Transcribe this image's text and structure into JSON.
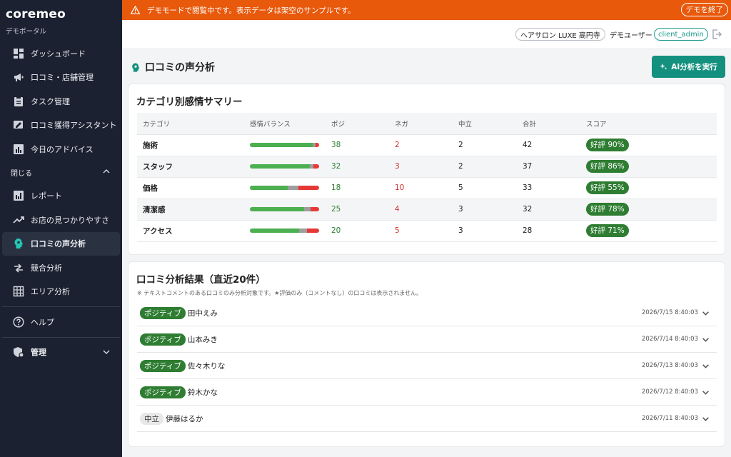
{
  "brand": {
    "name": "coremeo",
    "subtitle": "デモポータル"
  },
  "nav": {
    "items": [
      {
        "label": "ダッシュボード",
        "icon": "dashboard-icon"
      },
      {
        "label": "口コミ・店舗管理",
        "icon": "megaphone-icon"
      },
      {
        "label": "タスク管理",
        "icon": "clipboard-icon"
      },
      {
        "label": "口コミ獲得アシスタント",
        "icon": "edit-icon"
      },
      {
        "label": "今日のアドバイス",
        "icon": "bar-chart-icon"
      }
    ],
    "section_label": "閉じる",
    "section_items": [
      {
        "label": "レポート",
        "icon": "report-icon"
      },
      {
        "label": "お店の見つかりやすさ",
        "icon": "trending-up-icon"
      },
      {
        "label": "口コミの声分析",
        "icon": "head-icon",
        "active": true
      },
      {
        "label": "競合分析",
        "icon": "compare-icon"
      },
      {
        "label": "エリア分析",
        "icon": "grid-icon"
      }
    ],
    "help_label": "ヘルプ",
    "admin_label": "管理"
  },
  "banner": {
    "text": "デモモードで閲覧中です。表示データは架空のサンプルです。",
    "button": "デモを終了"
  },
  "header": {
    "store": "ヘアサロン LUXE 高円寺",
    "user_label": "デモユーザー",
    "user_id": "client_admin"
  },
  "page": {
    "title": "口コミの声分析",
    "ai_button": "AI分析を実行"
  },
  "summary": {
    "title": "カテゴリ別感情サマリー",
    "columns": [
      "カテゴリ",
      "感情バランス",
      "ポジ",
      "ネガ",
      "中立",
      "合計",
      "スコア"
    ],
    "rows": [
      {
        "category": "施術",
        "pos": "38",
        "neg": "2",
        "neu": "2",
        "total": "42",
        "score": "好評 90%",
        "p": 38,
        "n": 2,
        "m": 2
      },
      {
        "category": "スタッフ",
        "pos": "32",
        "neg": "3",
        "neu": "2",
        "total": "37",
        "score": "好評 86%",
        "p": 32,
        "n": 3,
        "m": 2
      },
      {
        "category": "価格",
        "pos": "18",
        "neg": "10",
        "neu": "5",
        "total": "33",
        "score": "好評 55%",
        "p": 18,
        "n": 10,
        "m": 5
      },
      {
        "category": "清潔感",
        "pos": "25",
        "neg": "4",
        "neu": "3",
        "total": "32",
        "score": "好評 78%",
        "p": 25,
        "n": 4,
        "m": 3
      },
      {
        "category": "アクセス",
        "pos": "20",
        "neg": "5",
        "neu": "3",
        "total": "28",
        "score": "好評 71%",
        "p": 20,
        "n": 5,
        "m": 3
      }
    ]
  },
  "results": {
    "title": "口コミ分析結果（直近20件）",
    "note": "※ テキストコメントのある口コミのみ分析対象です。★評価のみ（コメントなし）の口コミは表示されません。",
    "items": [
      {
        "tag": "ポジティブ",
        "type": "pos",
        "name": "田中えみ",
        "date": "2026/7/15 8:40:03"
      },
      {
        "tag": "ポジティブ",
        "type": "pos",
        "name": "山本みき",
        "date": "2026/7/14 8:40:03"
      },
      {
        "tag": "ポジティブ",
        "type": "pos",
        "name": "佐々木りな",
        "date": "2026/7/13 8:40:03"
      },
      {
        "tag": "ポジティブ",
        "type": "pos",
        "name": "鈴木かな",
        "date": "2026/7/12 8:40:03"
      },
      {
        "tag": "中立",
        "type": "neu",
        "name": "伊藤はるか",
        "date": "2026/7/11 8:40:03"
      }
    ]
  },
  "colors": {
    "banner": "#e8590c",
    "sidebar": "#1b2130",
    "accent": "#14907f",
    "positive": "#2e7d32",
    "negative": "#d32f2f"
  }
}
